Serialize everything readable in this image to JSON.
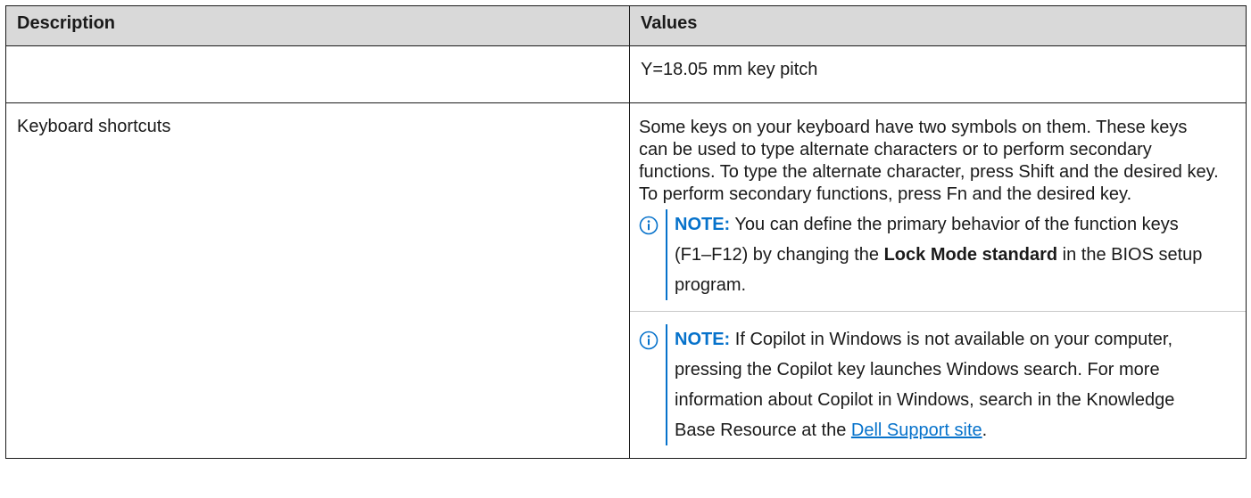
{
  "table": {
    "headers": {
      "description": "Description",
      "values": "Values"
    },
    "row1": {
      "description": "",
      "value": "Y=18.05 mm key pitch"
    },
    "row2": {
      "description": "Keyboard shortcuts",
      "paragraph": "Some keys on your keyboard have two symbols on them. These keys can be used to type alternate characters or to perform secondary functions. To type the alternate character, press Shift and the desired key. To perform secondary functions, press Fn and the desired key.",
      "note1": {
        "label": "NOTE:",
        "text_before": " You can define the primary behavior of the function keys (F1–F12) by changing the ",
        "bold": "Lock Mode standard",
        "text_after": " in the BIOS setup program."
      },
      "note2": {
        "label": "NOTE:",
        "text_before": " If Copilot in Windows is not available on your computer, pressing the Copilot key launches Windows search. For more information about Copilot in Windows, search in the Knowledge Base Resource at the ",
        "link": "Dell Support site",
        "text_after": "."
      }
    }
  },
  "colors": {
    "accent": "#0672cb",
    "header_bg": "#d9d9d9",
    "border": "#1a1a1a"
  },
  "icons": {
    "note": "info-circle-icon"
  }
}
